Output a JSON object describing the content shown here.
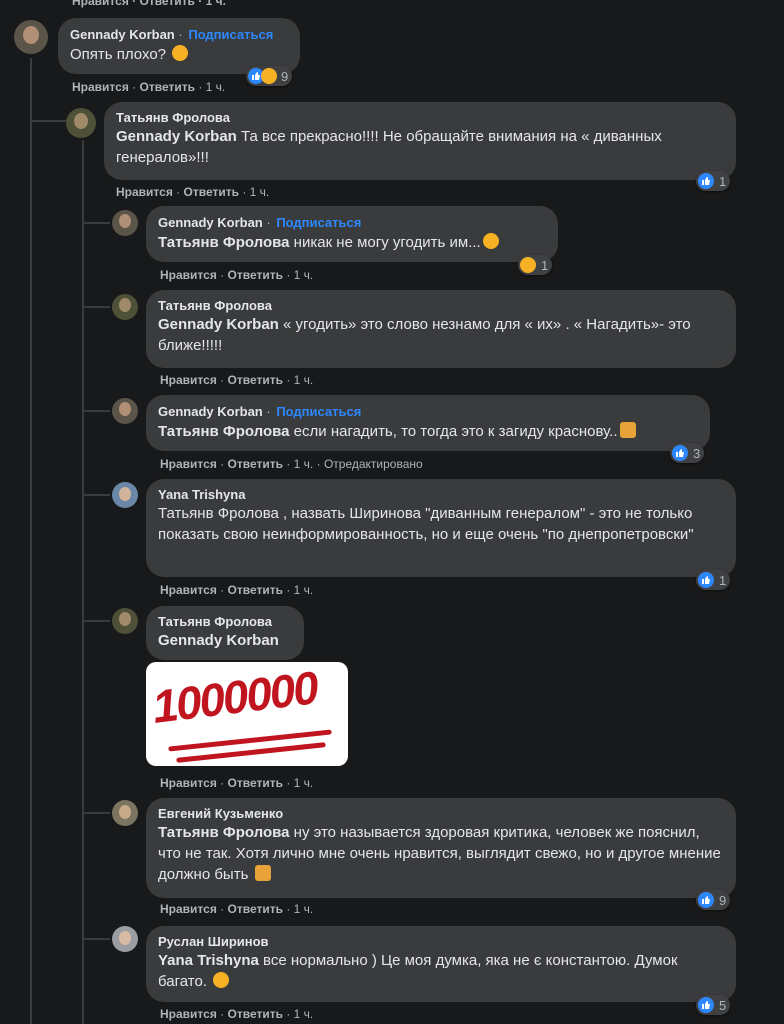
{
  "top_partial": {
    "actions": "Нравится · Ответить · 1 ч."
  },
  "comments": [
    {
      "author": "Gennady Korban",
      "follow": "Подписаться",
      "text": "Опять плохо? ",
      "like": "Нравится",
      "reply": "Ответить",
      "time": "1 ч.",
      "reactions": "9"
    },
    {
      "author": "Татьянв Фролова",
      "mention": "Gennady Korban",
      "text": " Та все прекрасно!!!! Не обращайте внимания на « диванных генералов»!!!",
      "like": "Нравится",
      "reply": "Ответить",
      "time": "1 ч.",
      "reactions": "1"
    },
    {
      "author": "Gennady Korban",
      "follow": "Подписаться",
      "mention": "Татьянв Фролова",
      "text": " никак не могу угодить им...",
      "like": "Нравится",
      "reply": "Ответить",
      "time": "1 ч.",
      "reactions": "1"
    },
    {
      "author": "Татьянв Фролова",
      "mention": "Gennady Korban",
      "text": " « угодить» это слово незнамо для « их» . « Нагадить»- это ближе!!!!!",
      "like": "Нравится",
      "reply": "Ответить",
      "time": "1 ч."
    },
    {
      "author": "Gennady Korban",
      "follow": "Подписаться",
      "mention": "Татьянв Фролова",
      "text": " если нагадить, то тогда это к загиду краснову..",
      "like": "Нравится",
      "reply": "Ответить",
      "time": "1 ч.",
      "edited": "Отредактировано",
      "reactions": "3"
    },
    {
      "author": "Yana Trishyna",
      "text": "Татьянв Фролова , назвать Ширинова \"диванным генералом\" - это не только показать свою неинформированность, но и еще очень \"по днепропетровски\"",
      "like": "Нравится",
      "reply": "Ответить",
      "time": "1 ч.",
      "reactions": "1"
    },
    {
      "author": "Татьянв Фролова",
      "mention": "Gennady Korban",
      "sticker": "1000000",
      "like": "Нравится",
      "reply": "Ответить",
      "time": "1 ч."
    },
    {
      "author": "Евгений Кузьменко",
      "mention": "Татьянв Фролова",
      "text": " ну это называется здоровая критика, человек же пояснил, что не так. Хотя лично мне очень нравится, выглядит свежо, но и другое мнение должно быть ",
      "like": "Нравится",
      "reply": "Ответить",
      "time": "1 ч.",
      "reactions": "9"
    },
    {
      "author": "Руслан Ширинов",
      "mention": "Yana Trishyna",
      "text": " все нормально ) Це моя думка, яка не є константою. Думок багато. ",
      "like": "Нравится",
      "reply": "Ответить",
      "time": "1 ч.",
      "reactions": "5"
    }
  ],
  "sep": "·",
  "colors": {
    "background": "#18191a",
    "bubble": "#3a3b3c",
    "text": "#e4e6eb",
    "meta": "#b0b3b8",
    "link": "#2d88ff",
    "sticker": "#c0151f"
  }
}
